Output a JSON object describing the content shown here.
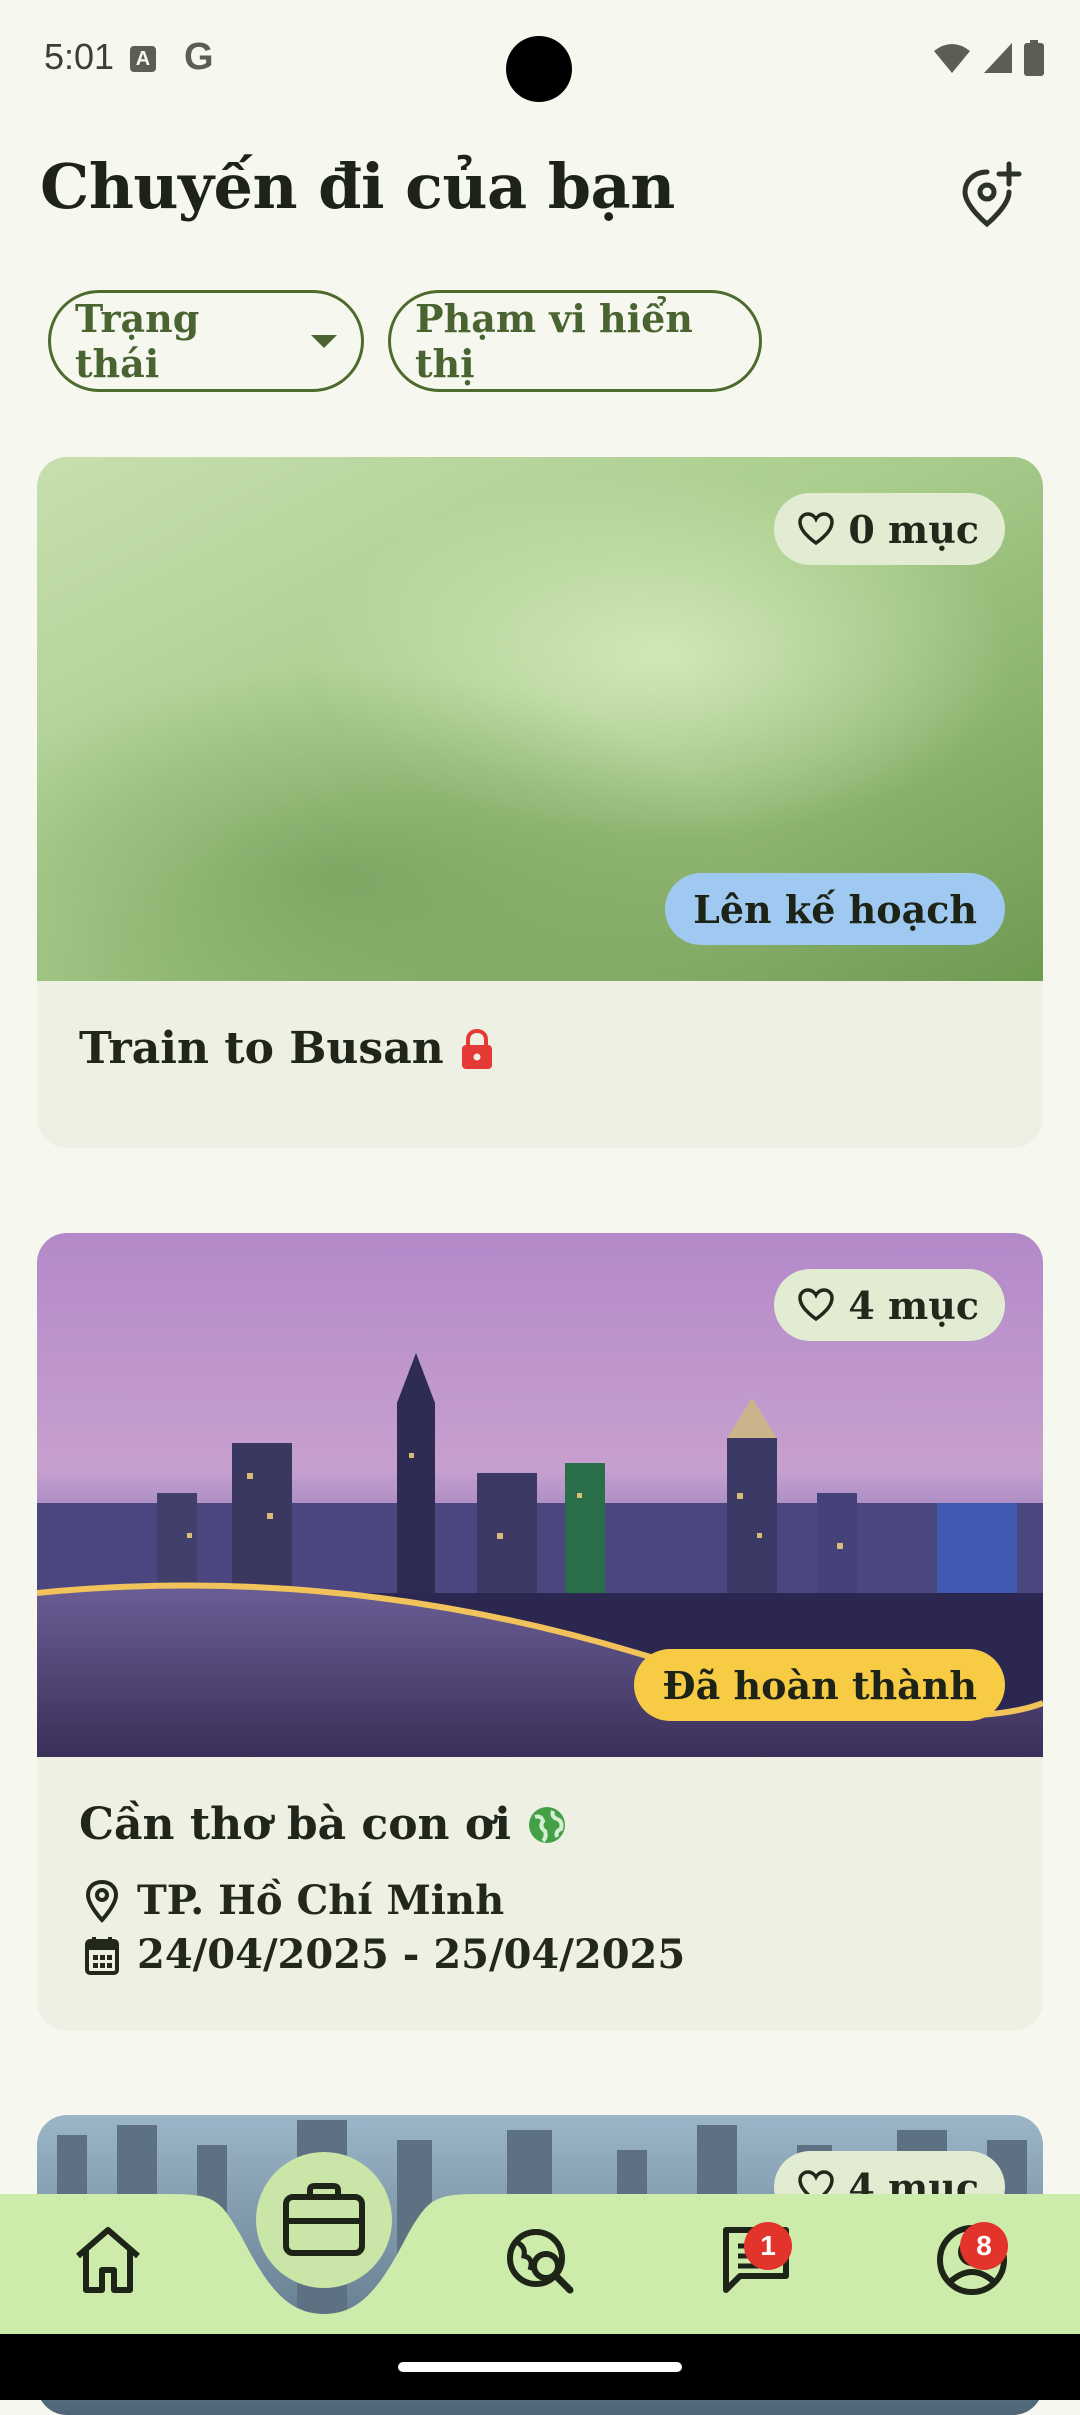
{
  "status_bar": {
    "time": "5:01",
    "a_icon": "A",
    "g_icon": "G"
  },
  "header": {
    "title": "Chuyến đi của bạn",
    "add_icon": "add-location-icon"
  },
  "filters": {
    "status_label": "Trạng thái",
    "range_label": "Phạm vi hiển thị"
  },
  "trips": [
    {
      "title": "Train to Busan",
      "favorites": "0 mục",
      "status": "Lên kế hoạch",
      "status_color": "#9fc9f0",
      "privacy_icon": "lock-icon",
      "privacy_color": "#e53935"
    },
    {
      "title": "Cần thơ bà con ơi",
      "favorites": "4 mục",
      "status": "Đã hoàn thành",
      "status_color": "#f8cb45",
      "privacy_icon": "globe-icon",
      "privacy_color": "#43a047",
      "location": "TP. Hồ Chí Minh",
      "dates": "24/04/2025 - 25/04/2025"
    },
    {
      "favorites": "4 mục"
    }
  ],
  "bottom_nav": {
    "items": [
      "home-icon",
      "briefcase-icon",
      "travel-explore-icon",
      "chat-icon",
      "profile-icon"
    ],
    "chat_badge": "1",
    "profile_badge": "8",
    "bar_color": "#cdebab"
  }
}
